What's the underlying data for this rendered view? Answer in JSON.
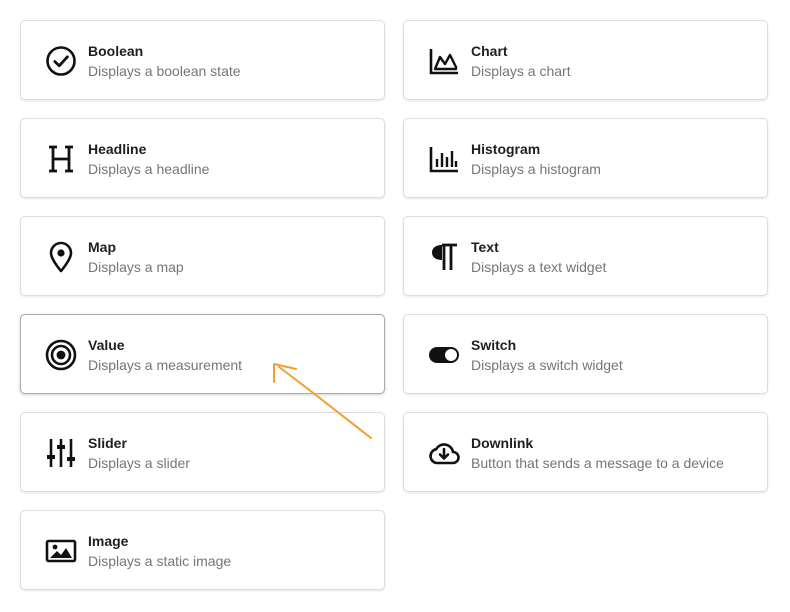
{
  "widgets": [
    {
      "title": "Boolean",
      "description": "Displays a boolean state",
      "icon": "check-circle-icon"
    },
    {
      "title": "Chart",
      "description": "Displays a chart",
      "icon": "area-chart-icon"
    },
    {
      "title": "Headline",
      "description": "Displays a headline",
      "icon": "headline-h-icon"
    },
    {
      "title": "Histogram",
      "description": "Displays a histogram",
      "icon": "histogram-icon"
    },
    {
      "title": "Map",
      "description": "Displays a map",
      "icon": "map-pin-icon"
    },
    {
      "title": "Text",
      "description": "Displays a text widget",
      "icon": "pilcrow-icon"
    },
    {
      "title": "Value",
      "description": "Displays a measurement",
      "icon": "target-icon"
    },
    {
      "title": "Switch",
      "description": "Displays a switch widget",
      "icon": "toggle-switch-icon"
    },
    {
      "title": "Slider",
      "description": "Displays a slider",
      "icon": "sliders-icon"
    },
    {
      "title": "Downlink",
      "description": "Button that sends a message to a device",
      "icon": "cloud-download-icon"
    },
    {
      "title": "Image",
      "description": "Displays a static image",
      "icon": "image-icon"
    }
  ],
  "highlighted_widget": "Value",
  "colors": {
    "card_border": "#dcdcdc",
    "title_text": "#1f1f1f",
    "description_text": "#757575",
    "annotation_arrow": "#f5a02c"
  }
}
